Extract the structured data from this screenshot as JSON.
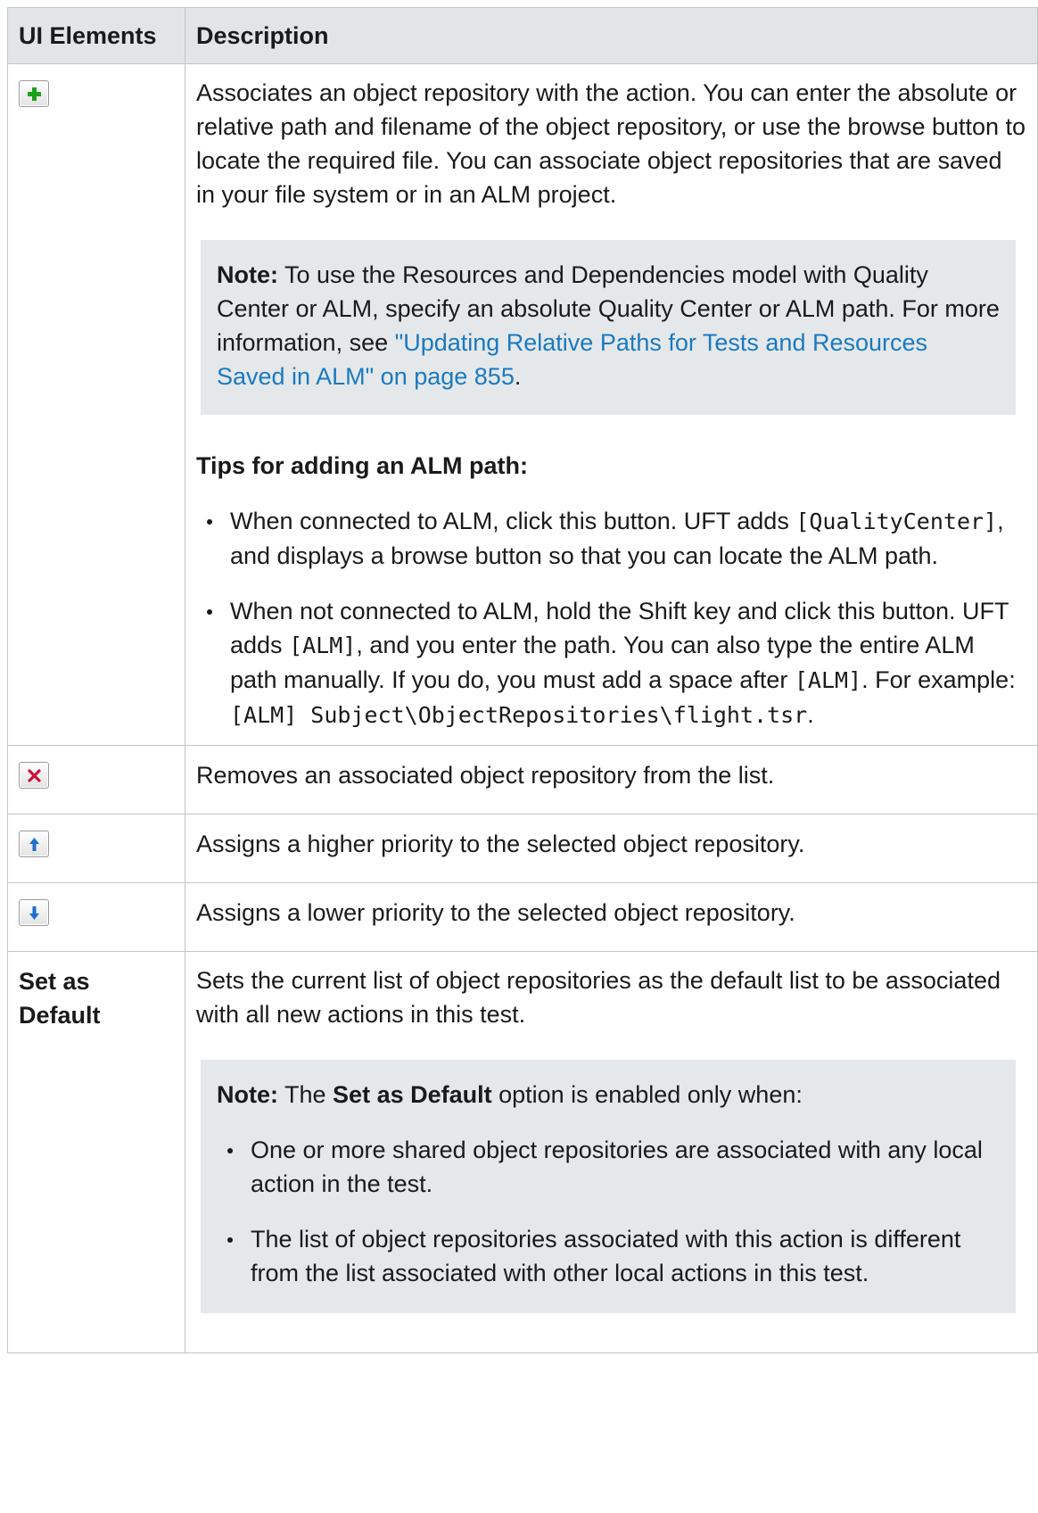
{
  "header": {
    "col1": "UI Elements",
    "col2": "Description"
  },
  "rows": {
    "add": {
      "icon": "add-icon",
      "desc": "Associates an object repository with the action. You can enter the absolute or relative path and filename of the object repository, or use the browse button to locate the required file. You can associate object repositories that are saved in your file system or in an ALM project.",
      "note": {
        "label": "Note:",
        "text": " To use the Resources and Dependencies model with Quality Center or ALM, specify an absolute Quality Center or ALM path. For more information, see ",
        "link": "\"Updating Relative Paths for Tests and Resources Saved in ALM\" on page 855",
        "end": "."
      },
      "tips_title": "Tips for adding an ALM path:",
      "tip1": {
        "a": "When connected to ALM, click this button. UFT adds ",
        "code": "[QualityCenter]",
        "b": ", and displays a browse button so that you can locate the ALM path."
      },
      "tip2": {
        "a": "When not connected to ALM, hold the Shift key and click this button. UFT adds ",
        "code1": "[ALM]",
        "b": ", and you enter the path. You can also type the entire ALM path manually. If you do, you must add a space after ",
        "code2": "[ALM]",
        "c": ". For example: ",
        "code3": "[ALM] Subject\\ObjectRepositories\\flight.tsr",
        "d": "."
      }
    },
    "remove": {
      "icon": "remove-icon",
      "desc": "Removes an associated object repository from the list."
    },
    "up": {
      "icon": "arrow-up-icon",
      "desc": "Assigns a higher priority to the selected object repository."
    },
    "down": {
      "icon": "arrow-down-icon",
      "desc": "Assigns a lower priority to the selected object repository."
    },
    "default": {
      "label": "Set as Default",
      "desc": "Sets the current list of object repositories as the default list to be associated with all new actions in this test.",
      "note": {
        "label": "Note:",
        "pre": " The ",
        "bold": "Set as Default",
        "post": " option is enabled only when:",
        "item1": "One or more shared object repositories are associated with any local action in the test.",
        "item2": "The list of object repositories associated with this action is different from the list associated with other local actions in this test."
      }
    }
  },
  "colors": {
    "header_bg": "#e2e5e7",
    "note_bg": "#e4e8ea",
    "link": "#1b79bf",
    "add_icon": "#1aa31a",
    "remove_icon": "#d0103a",
    "arrow_icon": "#1c6fd0"
  }
}
